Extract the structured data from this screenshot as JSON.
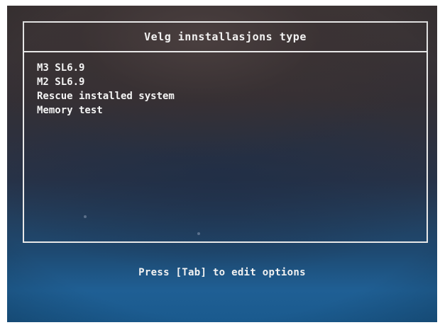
{
  "dialog": {
    "title": "Velg innstallasjons type"
  },
  "menu": {
    "items": [
      {
        "label": "M3 SL6.9"
      },
      {
        "label": "M2 SL6.9"
      },
      {
        "label": "Rescue installed system"
      },
      {
        "label": "Memory test"
      }
    ]
  },
  "footer": {
    "hint": "Press [Tab] to edit options"
  }
}
